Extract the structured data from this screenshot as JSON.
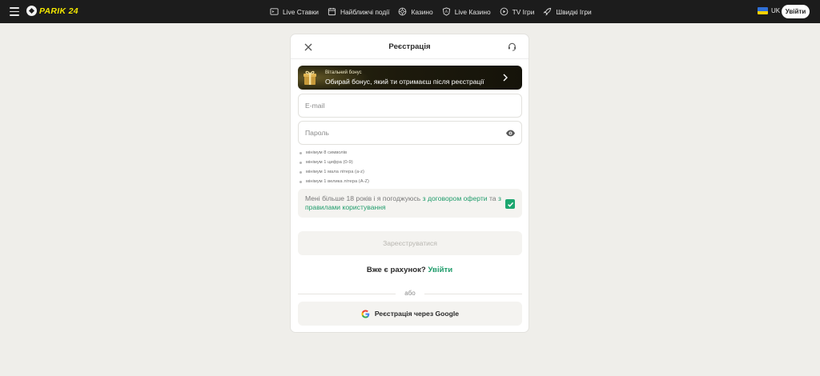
{
  "header": {
    "logo_text": "PARIK 24",
    "nav": [
      {
        "label": "Live Ставки",
        "icon": "live-bets-icon"
      },
      {
        "label": "Найближчі події",
        "icon": "calendar-icon"
      },
      {
        "label": "Казино",
        "icon": "casino-chip-icon"
      },
      {
        "label": "Live Казино",
        "icon": "live-casino-icon"
      },
      {
        "label": "TV Ігри",
        "icon": "tv-games-icon"
      },
      {
        "label": "Швидкі Ігри",
        "icon": "rocket-icon"
      }
    ],
    "language": "UK",
    "login_label": "Увійти"
  },
  "modal": {
    "title": "Реєстрація",
    "bonus": {
      "label": "Вітальний бонус",
      "text": "Обирай бонус, який ти отримаєш після реєстрації"
    },
    "email_placeholder": "E-mail",
    "password_placeholder": "Пароль",
    "password_rules": [
      "мінімум 8 символів",
      "мінімум 1 цифра (0-9)",
      "мінімум 1 мала літера (a-z)",
      "мінімум 1 велика літера (A-Z)"
    ],
    "agreement": {
      "prefix": "Мені більше 18 років і я погоджуюсь ",
      "link1": "з договором оферти",
      "middle": " та ",
      "link2": "з правилами користування",
      "checked": true
    },
    "register_label": "Зареєструватися",
    "have_account_text": "Вже є рахунок?",
    "login_link": "Увійти",
    "or_text": "або",
    "google_label": "Реєстрація через Google"
  },
  "colors": {
    "topbar_bg": "#1c1c1c",
    "logo_yellow": "#f2e600",
    "accent_green": "#1f9c6b",
    "page_bg": "#efeeea"
  }
}
